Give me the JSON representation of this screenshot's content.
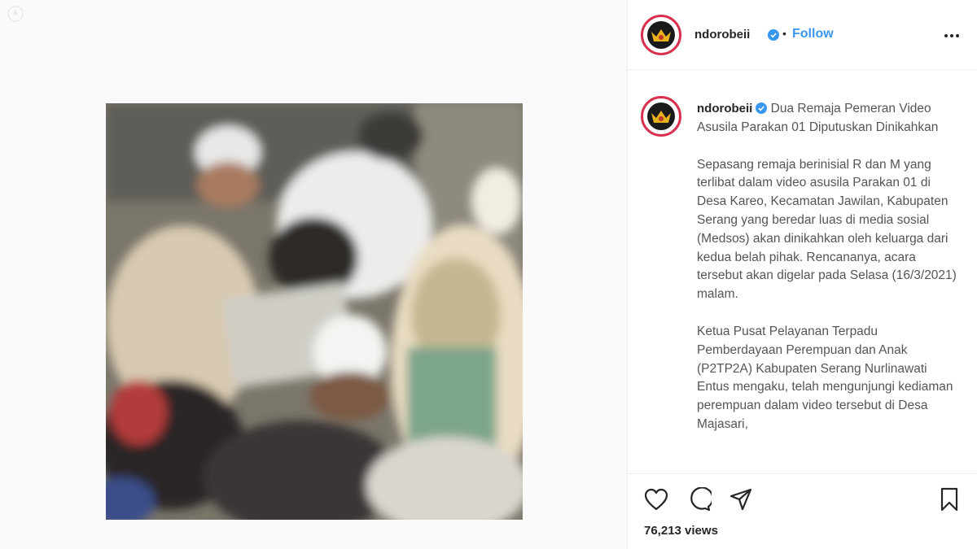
{
  "post": {
    "username": "ndorobeii",
    "verified": true,
    "follow_label": "Follow",
    "separator": "•"
  },
  "caption": {
    "username": "ndorobeii",
    "headline": "Dua Remaja Pemeran Video Asusila Parakan 01 Diputuskan Dinikahkan",
    "paragraphs": [
      "Sepasang remaja berinisial R dan M yang terlibat dalam video asusila Parakan 01 di Desa Kareo, Kecamatan Jawilan, Kabupaten Serang yang beredar luas di media sosial (Medsos) akan dinikahkan oleh keluarga dari kedua belah pihak. Rencananya, acara tersebut akan digelar pada Selasa (16/3/2021) malam.",
      "Ketua Pusat Pelayanan Terpadu Pemberdayaan Perempuan dan Anak (P2TP2A) Kabupaten Serang Nurlinawati Entus mengaku, telah mengunjungi kediaman perempuan dalam video tersebut di Desa Majasari,"
    ]
  },
  "stats": {
    "views": "76,213 views"
  },
  "icons": {
    "more": "more-options-icon",
    "like": "heart-icon",
    "comment": "comment-icon",
    "share": "send-icon",
    "save": "bookmark-icon",
    "verified": "verified-badge-icon"
  },
  "colors": {
    "follow": "#3897f0",
    "verified": "#3897f0",
    "avatar_ring": "#d9304f"
  }
}
